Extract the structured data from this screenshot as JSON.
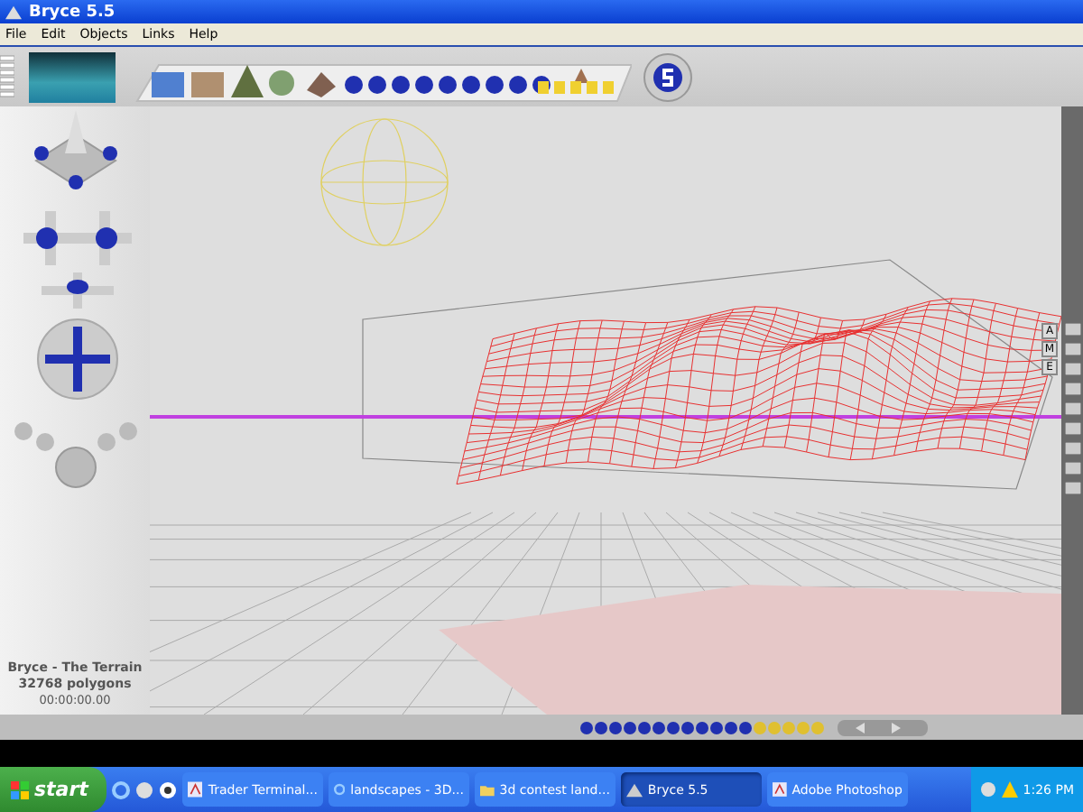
{
  "window": {
    "title": "Bryce 5.5"
  },
  "menu": [
    "File",
    "Edit",
    "Objects",
    "Links",
    "Help"
  ],
  "scene_info": {
    "name": "Bryce - The Terrain",
    "polygons": "32768 polygons",
    "time": "00:00:00.00"
  },
  "view_letters": [
    "A",
    "M",
    "E"
  ],
  "taskbar": {
    "start": "start",
    "tasks": [
      {
        "label": "Trader Terminal...",
        "kind": "app",
        "selected": false
      },
      {
        "label": "landscapes - 3D...",
        "kind": "browser",
        "selected": false
      },
      {
        "label": "3d contest land...",
        "kind": "folder",
        "selected": false
      },
      {
        "label": "Bryce 5.5",
        "kind": "bryce",
        "selected": true
      },
      {
        "label": "Adobe Photoshop",
        "kind": "app",
        "selected": false
      }
    ],
    "clock": "1:26 PM"
  }
}
